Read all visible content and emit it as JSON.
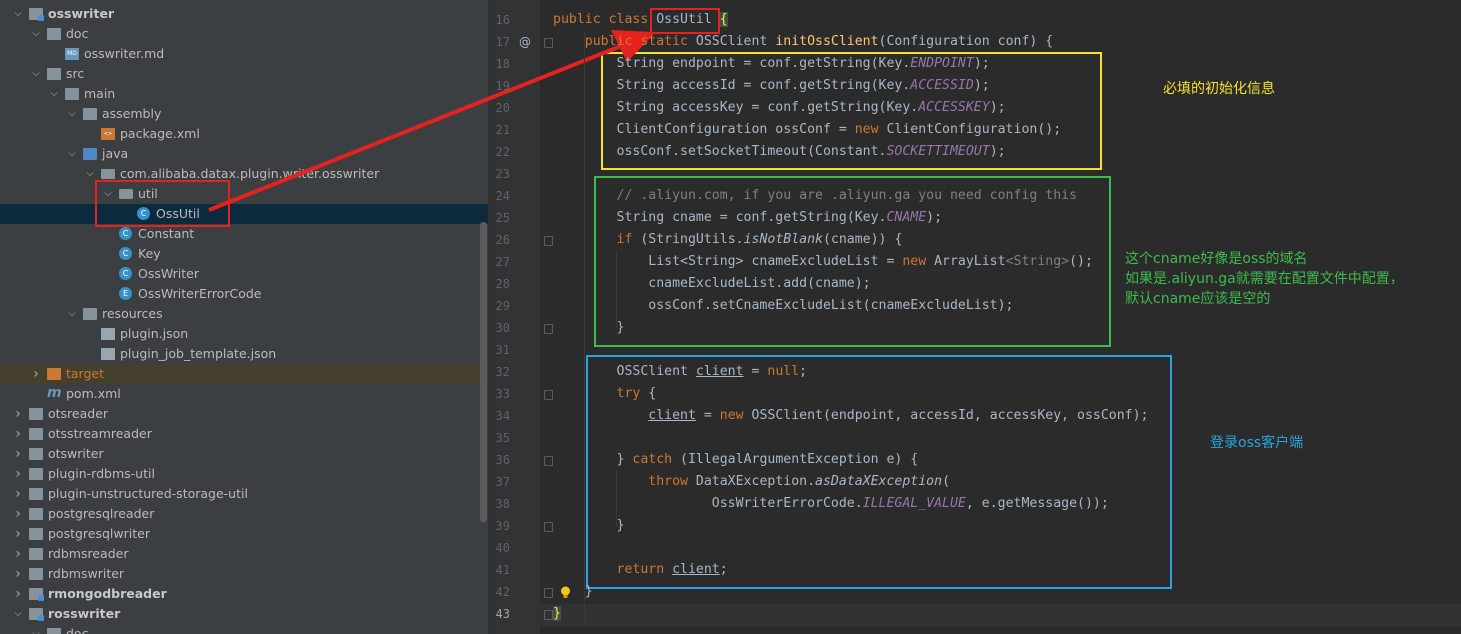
{
  "project_tree": {
    "items": [
      {
        "label": "osswriter",
        "depth": 0,
        "expanded": true,
        "icon": "module-folder",
        "bold": true
      },
      {
        "label": "doc",
        "depth": 1,
        "expanded": true,
        "icon": "folder"
      },
      {
        "label": "osswriter.md",
        "depth": 2,
        "icon": "markdown-file"
      },
      {
        "label": "src",
        "depth": 1,
        "expanded": true,
        "icon": "folder"
      },
      {
        "label": "main",
        "depth": 2,
        "expanded": true,
        "icon": "folder"
      },
      {
        "label": "assembly",
        "depth": 3,
        "expanded": true,
        "icon": "folder"
      },
      {
        "label": "package.xml",
        "depth": 4,
        "icon": "xml-file"
      },
      {
        "label": "java",
        "depth": 3,
        "expanded": true,
        "icon": "source-folder"
      },
      {
        "label": "com.alibaba.datax.plugin.writer.osswriter",
        "depth": 4,
        "expanded": true,
        "icon": "package"
      },
      {
        "label": "util",
        "depth": 5,
        "expanded": true,
        "icon": "package"
      },
      {
        "label": "OssUtil",
        "depth": 6,
        "icon": "class",
        "selected": true
      },
      {
        "label": "Constant",
        "depth": 5,
        "icon": "class"
      },
      {
        "label": "Key",
        "depth": 5,
        "icon": "class"
      },
      {
        "label": "OssWriter",
        "depth": 5,
        "icon": "class"
      },
      {
        "label": "OssWriterErrorCode",
        "depth": 5,
        "icon": "enum"
      },
      {
        "label": "resources",
        "depth": 3,
        "expanded": true,
        "icon": "resources-folder"
      },
      {
        "label": "plugin.json",
        "depth": 4,
        "icon": "json-file"
      },
      {
        "label": "plugin_job_template.json",
        "depth": 4,
        "icon": "json-file"
      },
      {
        "label": "target",
        "depth": 1,
        "expanded": false,
        "icon": "excluded-folder",
        "excluded": true
      },
      {
        "label": "pom.xml",
        "depth": 1,
        "icon": "maven-file"
      },
      {
        "label": "otsreader",
        "depth": 0,
        "expanded": false,
        "icon": "folder"
      },
      {
        "label": "otsstreamreader",
        "depth": 0,
        "expanded": false,
        "icon": "folder"
      },
      {
        "label": "otswriter",
        "depth": 0,
        "expanded": false,
        "icon": "folder"
      },
      {
        "label": "plugin-rdbms-util",
        "depth": 0,
        "expanded": false,
        "icon": "folder"
      },
      {
        "label": "plugin-unstructured-storage-util",
        "depth": 0,
        "expanded": false,
        "icon": "folder"
      },
      {
        "label": "postgresqlreader",
        "depth": 0,
        "expanded": false,
        "icon": "folder"
      },
      {
        "label": "postgresqlwriter",
        "depth": 0,
        "expanded": false,
        "icon": "folder"
      },
      {
        "label": "rdbmsreader",
        "depth": 0,
        "expanded": false,
        "icon": "folder"
      },
      {
        "label": "rdbmswriter",
        "depth": 0,
        "expanded": false,
        "icon": "folder"
      },
      {
        "label": "rmongodbreader",
        "depth": 0,
        "expanded": false,
        "icon": "module-folder",
        "bold": true
      },
      {
        "label": "rosswriter",
        "depth": 0,
        "expanded": true,
        "icon": "module-folder",
        "bold": true
      },
      {
        "label": "doc",
        "depth": 1,
        "expanded": true,
        "icon": "folder"
      }
    ]
  },
  "editor": {
    "lines": [
      {
        "n": "16",
        "segs": [
          [
            "public class ",
            "kw"
          ],
          [
            "OssUtil",
            ""
          ],
          [
            " ",
            ""
          ],
          [
            "{",
            "brace-hl"
          ]
        ]
      },
      {
        "n": "17",
        "segs": [
          [
            "    public static ",
            "kw"
          ],
          [
            "OSSClient ",
            ""
          ],
          [
            "initOssClient",
            "fn"
          ],
          [
            "(Configuration conf) {",
            ""
          ]
        ]
      },
      {
        "n": "18",
        "segs": [
          [
            "        String endpoint = conf.getString(Key.",
            ""
          ],
          [
            "ENDPOINT",
            "cst"
          ],
          [
            ");",
            ""
          ]
        ]
      },
      {
        "n": "19",
        "segs": [
          [
            "        String accessId = conf.getString(Key.",
            ""
          ],
          [
            "ACCESSID",
            "cst"
          ],
          [
            ");",
            ""
          ]
        ]
      },
      {
        "n": "20",
        "segs": [
          [
            "        String accessKey = conf.getString(Key.",
            ""
          ],
          [
            "ACCESSKEY",
            "cst"
          ],
          [
            ");",
            ""
          ]
        ]
      },
      {
        "n": "21",
        "segs": [
          [
            "        ClientConfiguration ossConf = ",
            ""
          ],
          [
            "new ",
            "kw"
          ],
          [
            "ClientConfiguration();",
            ""
          ]
        ]
      },
      {
        "n": "22",
        "segs": [
          [
            "        ossConf.setSocketTimeout(Constant.",
            ""
          ],
          [
            "SOCKETTIMEOUT",
            "cst"
          ],
          [
            ");",
            ""
          ]
        ]
      },
      {
        "n": "23",
        "segs": []
      },
      {
        "n": "24",
        "segs": [
          [
            "        // .aliyun.com, if you are .aliyun.ga you need config this",
            "cm"
          ]
        ]
      },
      {
        "n": "25",
        "segs": [
          [
            "        String cname = conf.getString(Key.",
            ""
          ],
          [
            "CNAME",
            "cst"
          ],
          [
            ");",
            ""
          ]
        ]
      },
      {
        "n": "26",
        "segs": [
          [
            "        ",
            "kw"
          ],
          [
            "if ",
            "kw"
          ],
          [
            "(StringUtils.",
            ""
          ],
          [
            "isNotBlank",
            "it"
          ],
          [
            "(cname)) {",
            ""
          ]
        ]
      },
      {
        "n": "27",
        "segs": [
          [
            "            List<String> cnameExcludeList = ",
            ""
          ],
          [
            "new ",
            "kw"
          ],
          [
            "ArrayList",
            ""
          ],
          [
            "<String>",
            "gen"
          ],
          [
            "();",
            ""
          ]
        ]
      },
      {
        "n": "28",
        "segs": [
          [
            "            cnameExcludeList.add(cname);",
            ""
          ]
        ]
      },
      {
        "n": "29",
        "segs": [
          [
            "            ossConf.setCnameExcludeList(cnameExcludeList);",
            ""
          ]
        ]
      },
      {
        "n": "30",
        "segs": [
          [
            "        }",
            ""
          ]
        ]
      },
      {
        "n": "31",
        "segs": []
      },
      {
        "n": "32",
        "segs": [
          [
            "        OSSClient ",
            ""
          ],
          [
            "client",
            "ul"
          ],
          [
            " = ",
            ""
          ],
          [
            "null",
            "kw"
          ],
          [
            ";",
            ""
          ]
        ]
      },
      {
        "n": "33",
        "segs": [
          [
            "        ",
            "kw"
          ],
          [
            "try ",
            "kw"
          ],
          [
            "{",
            ""
          ]
        ]
      },
      {
        "n": "34",
        "segs": [
          [
            "            ",
            ""
          ],
          [
            "client",
            "ul"
          ],
          [
            " = ",
            ""
          ],
          [
            "new ",
            "kw"
          ],
          [
            "OSSClient(endpoint, accessId, accessKey, ossConf);",
            ""
          ]
        ]
      },
      {
        "n": "35",
        "segs": []
      },
      {
        "n": "36",
        "segs": [
          [
            "        } ",
            ""
          ],
          [
            "catch ",
            "kw"
          ],
          [
            "(IllegalArgumentException e) {",
            ""
          ]
        ]
      },
      {
        "n": "37",
        "segs": [
          [
            "            ",
            ""
          ],
          [
            "throw ",
            "kw"
          ],
          [
            "DataXException.",
            ""
          ],
          [
            "asDataXException",
            "it"
          ],
          [
            "(",
            ""
          ]
        ]
      },
      {
        "n": "38",
        "segs": [
          [
            "                    OssWriterErrorCode.",
            ""
          ],
          [
            "ILLEGAL_VALUE",
            "cst"
          ],
          [
            ", e.getMessage());",
            ""
          ]
        ]
      },
      {
        "n": "39",
        "segs": [
          [
            "        }",
            ""
          ]
        ]
      },
      {
        "n": "40",
        "segs": []
      },
      {
        "n": "41",
        "segs": [
          [
            "        ",
            ""
          ],
          [
            "return ",
            "kw"
          ],
          [
            "client",
            "ul"
          ],
          [
            ";",
            ""
          ]
        ]
      },
      {
        "n": "42",
        "segs": [
          [
            "    }",
            ""
          ]
        ]
      },
      {
        "n": "43",
        "segs": [
          [
            "}",
            "brace-hl"
          ]
        ]
      }
    ]
  },
  "annotations": {
    "required_init": "必填的初始化信息",
    "cname_line1": "这个cname好像是oss的域名",
    "cname_line2": "如果是.aliyun.ga就需要在配置文件中配置，",
    "cname_line3": "默认cname应该是空的",
    "login": "登录oss客户端"
  },
  "colors": {
    "yellow_box": "#f5e12e",
    "green_box": "#3dbb4c",
    "blue_box": "#28a4e0",
    "red_highlight": "#e5221e"
  }
}
